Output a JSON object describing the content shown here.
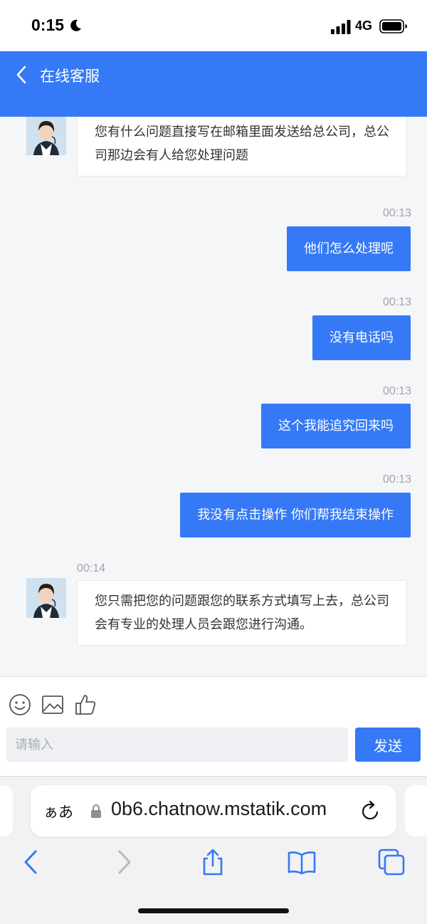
{
  "status_bar": {
    "time": "0:15",
    "network": "4G"
  },
  "header": {
    "title": "在线客服"
  },
  "messages": [
    {
      "side": "agent",
      "time": "",
      "text": "您有什么问题直接写在邮箱里面发送给总公司，总公司那边会有人给您处理问题"
    },
    {
      "side": "user",
      "time": "00:13",
      "text": "他们怎么处理呢"
    },
    {
      "side": "user",
      "time": "00:13",
      "text": "没有电话吗"
    },
    {
      "side": "user",
      "time": "00:13",
      "text": "这个我能追究回来吗"
    },
    {
      "side": "user",
      "time": "00:13",
      "text": "我没有点击操作 你们帮我结束操作"
    },
    {
      "side": "agent",
      "time": "00:14",
      "text": "您只需把您的问题跟您的联系方式填写上去，总公司会有专业的处理人员会跟您进行沟通。"
    }
  ],
  "input": {
    "placeholder": "请输入",
    "value": "",
    "send_label": "发送"
  },
  "toolbar_icons": [
    "emoji-icon",
    "image-icon",
    "thumbs-up-icon"
  ],
  "browser": {
    "aa_label": "ぁあ",
    "url": "0b6.chatnow.mstatik.com"
  },
  "colors": {
    "brand": "#3579f6",
    "background": "#f5f6f8"
  }
}
